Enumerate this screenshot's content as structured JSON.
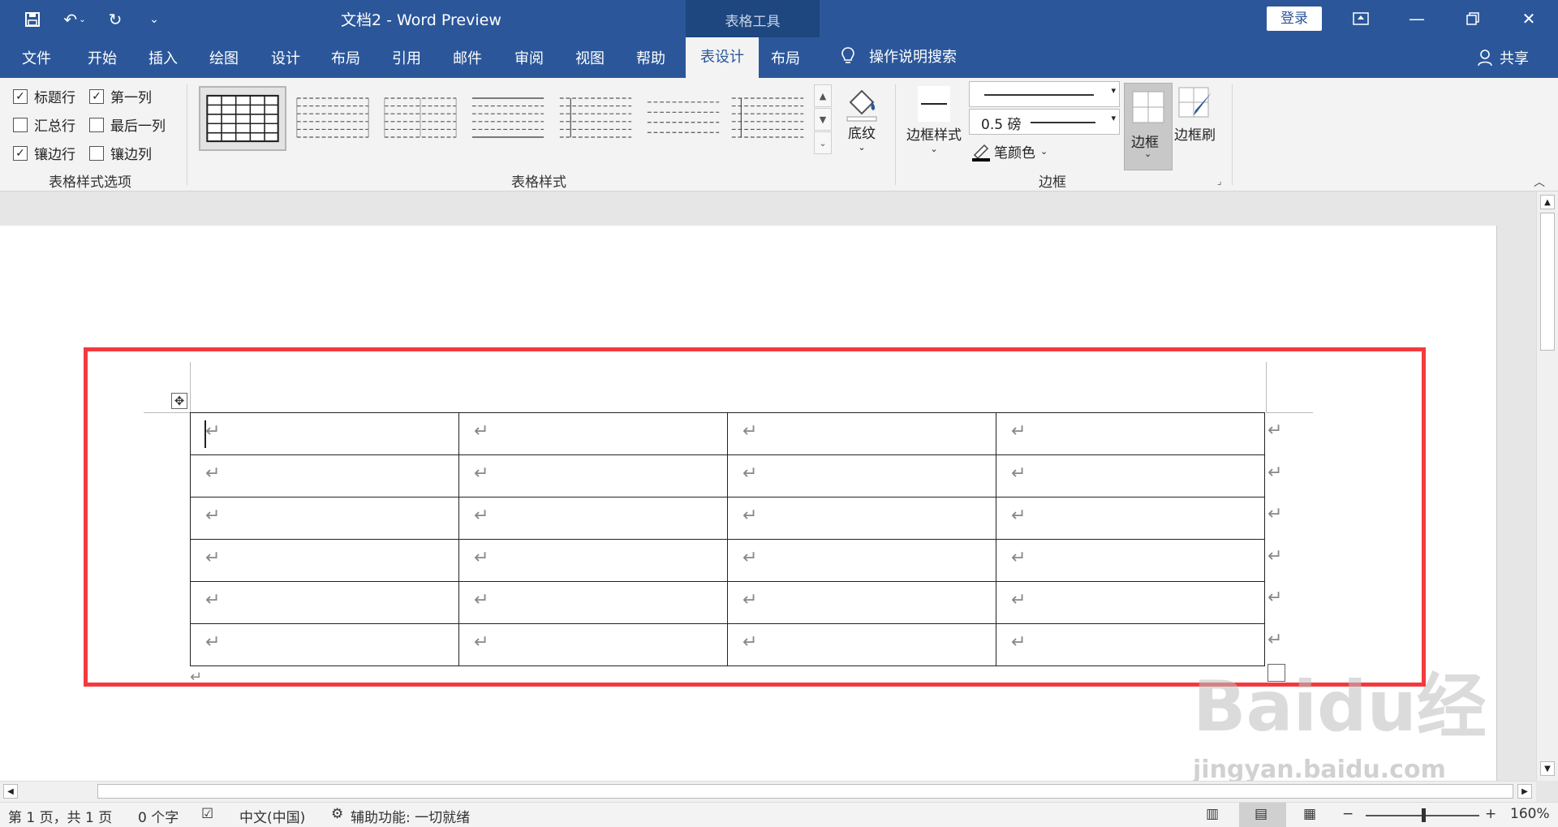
{
  "titlebar": {
    "doc_title": "文档2  -  Word Preview",
    "context_label": "表格工具",
    "login_label": "登录"
  },
  "tabs": {
    "file": "文件",
    "home": "开始",
    "insert": "插入",
    "draw": "绘图",
    "design": "设计",
    "layout": "布局",
    "references": "引用",
    "mailings": "邮件",
    "review": "审阅",
    "view": "视图",
    "help": "帮助",
    "table_design": "表设计",
    "table_layout": "布局",
    "tell_me": "操作说明搜索",
    "share": "共享"
  },
  "ribbon": {
    "options": {
      "header_row": "标题行",
      "first_column": "第一列",
      "total_row": "汇总行",
      "last_column": "最后一列",
      "banded_rows": "镶边行",
      "banded_columns": "镶边列",
      "group_label": "表格样式选项"
    },
    "styles": {
      "group_label": "表格样式",
      "shading": "底纹"
    },
    "borders": {
      "border_styles": "边框样式",
      "weight": "0.5 磅",
      "pen_color": "笔颜色",
      "borders": "边框",
      "border_painter": "边框刷",
      "group_label": "边框"
    }
  },
  "table": {
    "rows": 6,
    "cols": 4,
    "cell_mark": "↵"
  },
  "statusbar": {
    "page": "第 1 页，共 1 页",
    "words": "0 个字",
    "language": "中文(中国)",
    "accessibility": "辅助功能: 一切就绪",
    "zoom": "160%"
  },
  "watermark": {
    "brand": "Baidu经验",
    "url": "jingyan.baidu.com"
  },
  "colors": {
    "accent": "#2b579a",
    "highlight_box": "#f23a3f"
  }
}
